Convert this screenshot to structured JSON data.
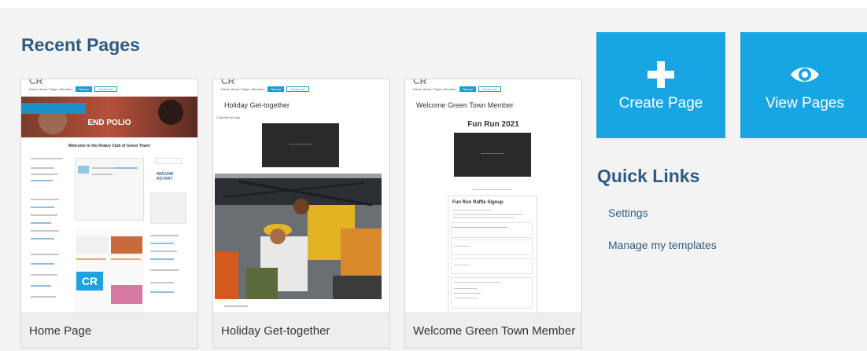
{
  "recent": {
    "title": "Recent Pages",
    "cards": [
      {
        "caption": "Home Page",
        "preview": {
          "nav": [
            "Home",
            "About",
            "Pages",
            "Members"
          ],
          "nav_buttons": [
            "Tiempo",
            "Social day"
          ],
          "hero_text": "END POLIO",
          "heading": "Welcome to the Rotary Club of Green Town!",
          "side_heading": "IMAGINE ROTARY",
          "tile_text": "CR"
        }
      },
      {
        "caption": "Holiday Get-together",
        "preview": {
          "nav": [
            "Home",
            "About",
            "Pages",
            "Members"
          ],
          "nav_buttons": [
            "Tiempo",
            "Social day"
          ],
          "heading": "Holiday Get-together",
          "sub": "Club/Service day"
        }
      },
      {
        "caption": "Welcome Green Town Member",
        "preview": {
          "nav": [
            "Home",
            "About",
            "Pages",
            "Members"
          ],
          "nav_buttons": [
            "Tiempo",
            "Social day"
          ],
          "heading": "Welcome Green Town Member",
          "event_title": "Fun Run 2021",
          "form_title": "Fun Run Raffle Signup"
        }
      }
    ]
  },
  "actions": {
    "create_label": "Create Page",
    "view_label": "View Pages",
    "accent": "#17a6e3"
  },
  "quick_links": {
    "title": "Quick Links",
    "items": [
      "Settings",
      "Manage my templates"
    ]
  }
}
